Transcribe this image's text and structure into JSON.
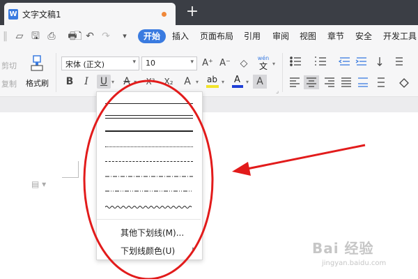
{
  "tab": {
    "title": "文字文稿1",
    "new_tab": "+",
    "icon_letter": "W"
  },
  "quick_access": {
    "icons": [
      "folder-icon",
      "save-icon",
      "print-preview-icon",
      "print-icon",
      "export-pdf-icon",
      "undo-icon",
      "redo-icon",
      "customize-icon"
    ],
    "glyphs": [
      "▱",
      "🖫",
      "⎙",
      "🖶",
      "🗋",
      "↶",
      "↷",
      "▾"
    ]
  },
  "menu": {
    "active": "开始",
    "items": [
      "插入",
      "页面布局",
      "引用",
      "审阅",
      "视图",
      "章节",
      "安全",
      "开发工具"
    ]
  },
  "ribbon": {
    "cut": "剪切",
    "copy": "复制",
    "format_painter": "格式刷",
    "font_name": "宋体 (正文)",
    "font_size": "10",
    "bold": "B",
    "italic": "I",
    "underline": "U",
    "strikethrough": "A",
    "superscript": "X²",
    "subscript": "X₂",
    "text_effects": "A",
    "highlight": "ab",
    "font_color": "A",
    "char_shading": "A",
    "grow_font": "A⁺",
    "shrink_font": "A⁻",
    "clear_format": "◇",
    "pinyin_top": "wén",
    "pinyin_bottom": "文",
    "highlight_color": "#f2e42b",
    "font_color_value": "#e02020"
  },
  "underline_menu": {
    "more": "其他下划线(M)...",
    "color": "下划线颜色(U)",
    "styles": [
      "single",
      "double",
      "thick",
      "dotted",
      "dashed",
      "dash-dot",
      "dash-dot-dot",
      "wave"
    ]
  },
  "watermark": {
    "main": "Bai 经验",
    "sub": "jingyan.baidu.com"
  },
  "colors": {
    "accent": "#3a7be0",
    "annotation": "#e21b1b",
    "tab_bar": "#3b3e45"
  }
}
